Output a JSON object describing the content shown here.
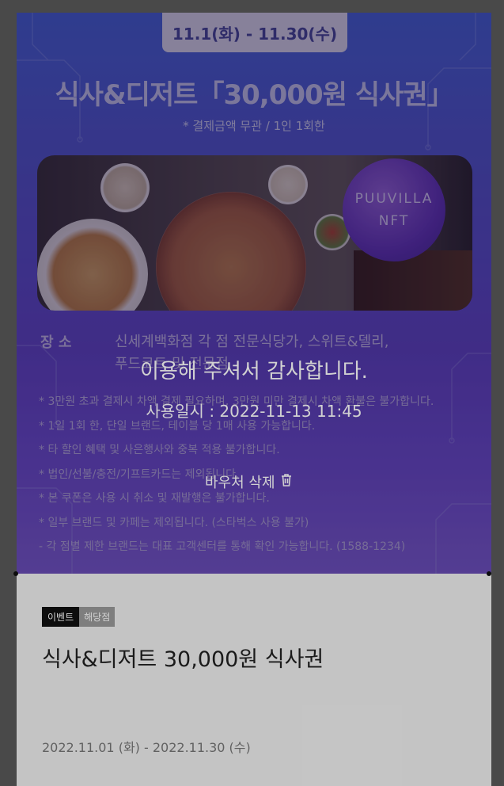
{
  "banner": {
    "date_tab": "11.1(화) - 11.30(수)",
    "headline": "식사&디저트「30,000원 식사권」",
    "subnote": "* 결제금액 무관 / 1인 1회한",
    "nft_badge": {
      "line1": "PUUVILLA",
      "line2": "NFT"
    },
    "place_label": "장  소",
    "place_text_line1": "신세계백화점 각 점 전문식당가, 스위트&델리,",
    "place_text_line2": "푸드코트 및 전문점",
    "notes": [
      "* 3만원 초과 결제시 차액 결제 필요하며, 3만원 미만 결제시 차액 환불은 불가합니다.",
      "* 1일 1회 한, 단일 브랜드, 테이블 당 1매 사용 가능합니다.",
      "* 타 할인 혜택 및 사은행사와 중복 적용 불가합니다.",
      "* 법인/선불/충전/기프트카드는 제외됩니다.",
      "* 본 쿠폰은 사용 시 취소 및 재발행은 불가합니다.",
      "* 일부 브랜드 및 카페는 제외됩니다. (스타벅스 사용 불가)",
      "  - 각 점별 제한 브랜드는 대표 고객센터를 통해 확인 가능합니다. (1588-1234)"
    ]
  },
  "overlay": {
    "thanks": "이용해 주셔서 감사합니다.",
    "used_at": "사용일시 : 2022-11-13 11:45",
    "delete_label": "바우처 삭제",
    "delete_icon": "trash-icon"
  },
  "details": {
    "badge_event": "이벤트",
    "badge_store": "해당점",
    "title": "식사&디저트 30,000원 식사권",
    "period": "2022.11.01 (화) - 2022.11.30 (수)"
  }
}
